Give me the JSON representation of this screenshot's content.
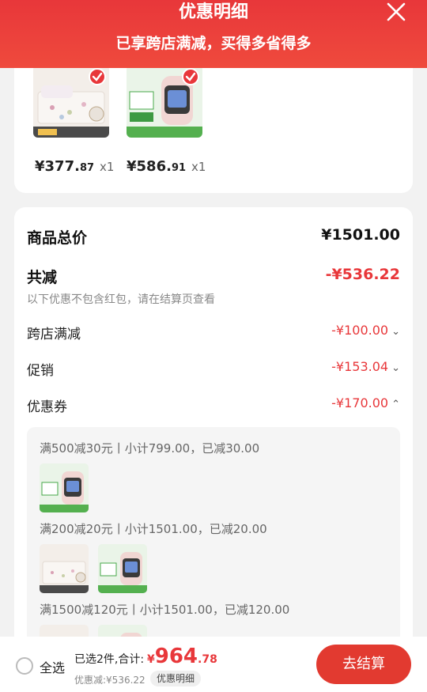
{
  "header": {
    "title": "优惠明细",
    "subtitle": "已享跨店满减，买得多省得多"
  },
  "products": [
    {
      "price_int": "¥377.",
      "price_dec": "87",
      "qty": "x1",
      "image": "bedding-set-image"
    },
    {
      "price_int": "¥586.",
      "price_dec": "91",
      "qty": "x1",
      "image": "kids-smartwatch-image"
    }
  ],
  "details": {
    "total_label": "商品总价",
    "total_value": "¥1501.00",
    "reduce_label": "共减",
    "reduce_value": "-¥536.22",
    "note": "以下优惠不包含红包，请在结算页查看",
    "items": [
      {
        "label": "跨店满减",
        "value": "-¥100.00",
        "chevron": "chevron-down"
      },
      {
        "label": "促销",
        "value": "-¥153.04",
        "chevron": "chevron-down"
      },
      {
        "label": "优惠券",
        "value": "-¥170.00",
        "chevron": "chevron-up"
      }
    ],
    "coupons": [
      {
        "text": "满500减30元丨小计799.00，已减30.00"
      },
      {
        "text": "满200减20元丨小计1501.00，已减20.00"
      },
      {
        "text": "满1500减120元丨小计1501.00，已减120.00"
      }
    ]
  },
  "bottom": {
    "select_all": "全选",
    "summary": "已选2件,合计:",
    "total_cur": "¥",
    "total_int": "964",
    "total_dec": ".78",
    "discount": "优惠减:¥536.22",
    "discount_tag": "优惠明细",
    "checkout": "去结算"
  },
  "colors": {
    "accent": "#e8373a",
    "button": "#e23a30"
  }
}
